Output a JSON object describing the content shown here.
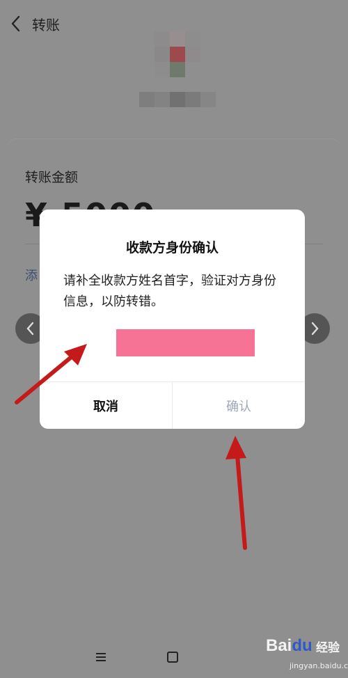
{
  "header": {
    "title": "转账"
  },
  "transfer": {
    "amount_label": "转账金额",
    "amount": "¥ 5000",
    "add_note": "添"
  },
  "dialog": {
    "title": "收款方身份确认",
    "message": "请补全收款方姓名首字，验证对方身份信息，以防转错。",
    "input_color": "#f67396",
    "cancel_label": "取消",
    "confirm_label": "确认"
  },
  "watermark": {
    "logo_a": "Bai",
    "logo_b": "du",
    "text": "经验",
    "url": "jingyan.baidu.com"
  },
  "colors": {
    "overlay": "#8f8f8f",
    "arrow": "#c41a1a",
    "link": "#3d4e75"
  }
}
